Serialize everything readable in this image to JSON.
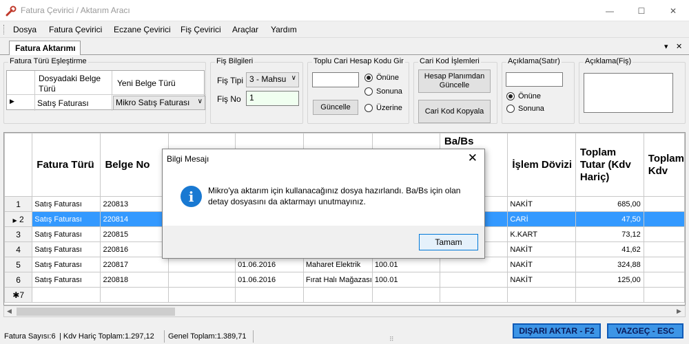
{
  "window": {
    "title": "Fatura Çevirici / Aktarım Aracı",
    "icon": "wrench-icon",
    "minimize_glyph": "—",
    "maximize_glyph": "☐",
    "close_glyph": "✕"
  },
  "menu": {
    "items": [
      "Dosya",
      "Fatura Çevirici",
      "Eczane Çevirici",
      "Fiş Çevirici",
      "Araçlar",
      "Yardım"
    ]
  },
  "tabs": {
    "active": "Fatura Aktarımı",
    "dropdown_glyph": "▾",
    "close_glyph": "✕"
  },
  "matching": {
    "title": "Fatura Türü Eşleştirme",
    "col1_header": "Dosyadaki Belge Türü",
    "col2_header": "Yeni Belge Türü",
    "row_marker": "▶",
    "row_source": "Satış Faturası",
    "row_target": "Mikro Satış Faturası",
    "combo_arrow": "∨"
  },
  "fis_bilgileri": {
    "title": "Fiş Bilgileri",
    "fis_tipi_label": "Fiş Tipi",
    "fis_tipi_value": "3 - Mahsu",
    "fis_no_label": "Fiş No",
    "fis_no_value": "1"
  },
  "toplu_cari": {
    "title": "Toplu Cari Hesap Kodu Gir",
    "input_value": "",
    "button": "Güncelle",
    "options": [
      "Önüne",
      "Sonuna",
      "Üzerine"
    ],
    "selected": 0
  },
  "cari_kod": {
    "title": "Cari Kod İşlemleri",
    "btn_update": "Hesap Planımdan Güncelle",
    "btn_copy": "Cari Kod Kopyala"
  },
  "aciklama_satir": {
    "title": "Açıklama(Satır)",
    "input_value": "",
    "options": [
      "Önüne",
      "Sonuna"
    ],
    "selected": 0
  },
  "aciklama_fis": {
    "title": "Açıklama(Fiş)",
    "input_value": ""
  },
  "grid": {
    "headers": [
      "Fatura Türü",
      "Belge No",
      "",
      "",
      "",
      "",
      "Ba/Bs",
      "İşlem Dövizi",
      "Toplam Tutar (Kdv Hariç)",
      "Toplam Kdv"
    ],
    "rows": [
      {
        "num": "1",
        "type": "Satış Faturası",
        "no": "220813",
        "c3": "",
        "date": "",
        "name": "",
        "code": "",
        "babs": "",
        "currency": "NAKİT",
        "total": "685,00",
        "kdv": ""
      },
      {
        "num": "2",
        "type": "Satış Faturası",
        "no": "220814",
        "c3": "",
        "date": "",
        "name": "",
        "code": "",
        "babs": "",
        "currency": "CARİ",
        "total": "47,50",
        "kdv": ""
      },
      {
        "num": "3",
        "type": "Satış Faturası",
        "no": "220815",
        "c3": "",
        "date": "",
        "name": "",
        "code": "",
        "babs": "",
        "currency": "K.KART",
        "total": "73,12",
        "kdv": ""
      },
      {
        "num": "4",
        "type": "Satış Faturası",
        "no": "220816",
        "c3": "",
        "date": "",
        "name": "",
        "code": "",
        "babs": "",
        "currency": "NAKİT",
        "total": "41,62",
        "kdv": ""
      },
      {
        "num": "5",
        "type": "Satış Faturası",
        "no": "220817",
        "c3": "",
        "date": "01.06.2016",
        "name": "Maharet Elektrik",
        "code": "100.01",
        "babs": "",
        "currency": "NAKİT",
        "total": "324,88",
        "kdv": ""
      },
      {
        "num": "6",
        "type": "Satış Faturası",
        "no": "220818",
        "c3": "",
        "date": "01.06.2016",
        "name": "Fırat Halı Mağazası",
        "code": "100.01",
        "babs": "",
        "currency": "NAKİT",
        "total": "125,00",
        "kdv": ""
      }
    ],
    "new_row_marker": "✱7",
    "selected_marker": "▶"
  },
  "status": {
    "count": "Fatura Sayısı:6",
    "kdv_haric": "Kdv Hariç Toplam:1.297,12",
    "genel": "Genel Toplam:1.389,71",
    "export_button": "DIŞARI AKTAR - F2",
    "cancel_button": "VAZGEÇ - ESC",
    "grip": "⠿"
  },
  "dialog": {
    "title": "Bilgi Mesajı",
    "close_glyph": "✕",
    "icon_glyph": "i",
    "message": "Mikro'ya aktarım için kullanacağınız dosya hazırlandı. Ba/Bs için olan detay dosyasını da aktarmayı unutmayınız.",
    "ok_button": "Tamam"
  }
}
